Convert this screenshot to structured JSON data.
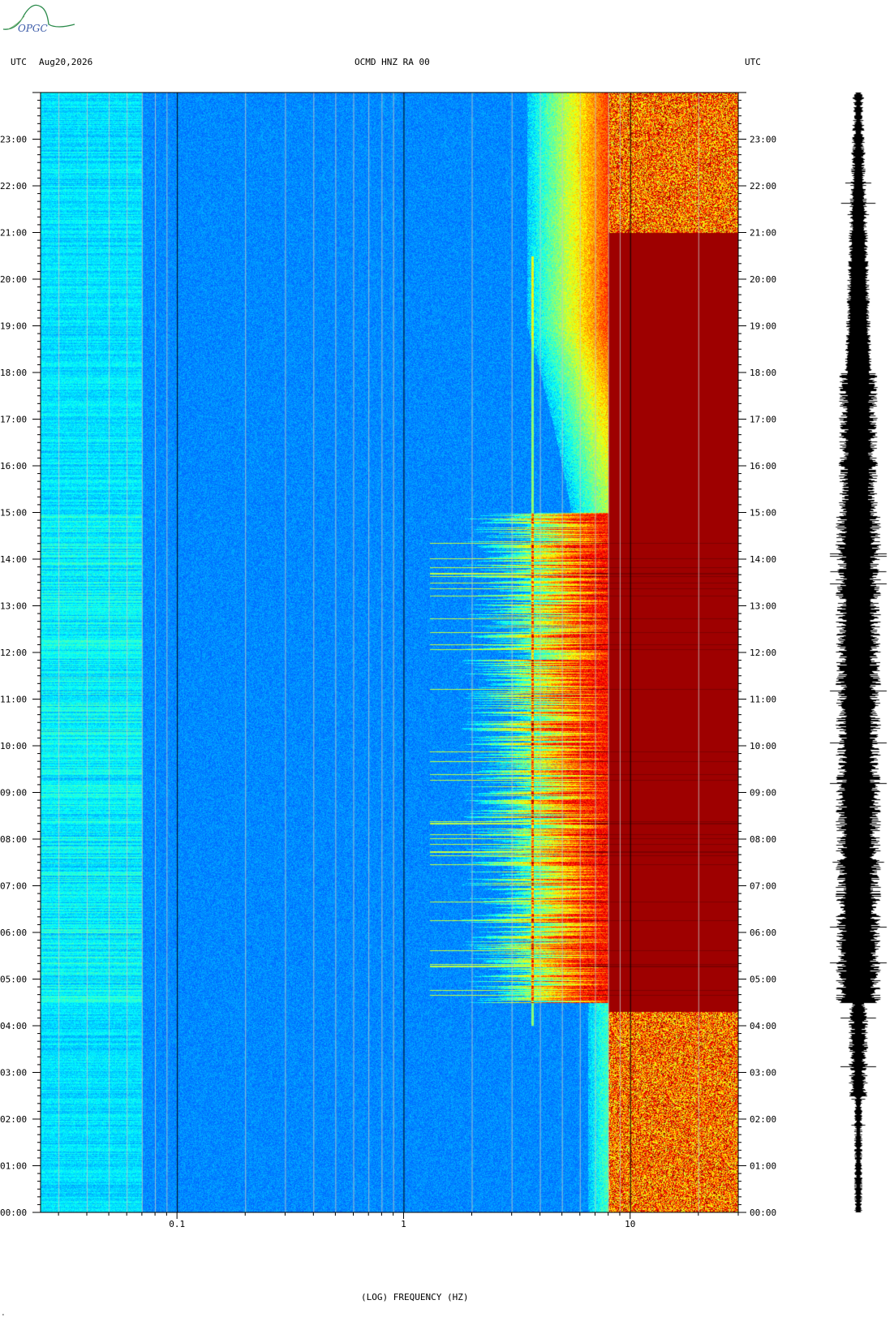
{
  "header": {
    "left_tz": "UTC",
    "date": "Aug20,2026",
    "station": "OCMD HNZ RA 00",
    "right_tz": "UTC"
  },
  "logo": {
    "text": "OPGC",
    "color": "#2a8a4a"
  },
  "footer": {
    "mark": "˚"
  },
  "chart_data": {
    "type": "heatmap",
    "title": "OCMD HNZ RA 00",
    "xlabel": "(LOG) FREQUENCY (HZ)",
    "ylabel": "UTC",
    "x_scale": "log",
    "xlim": [
      0.025,
      30
    ],
    "ylim_hours": [
      0,
      24
    ],
    "x_ticks": [
      {
        "value": 0.1,
        "label": "0.1"
      },
      {
        "value": 1,
        "label": "1"
      },
      {
        "value": 10,
        "label": "10"
      }
    ],
    "y_ticks": [
      "00:00",
      "01:00",
      "02:00",
      "03:00",
      "04:00",
      "05:00",
      "06:00",
      "07:00",
      "08:00",
      "09:00",
      "10:00",
      "11:00",
      "12:00",
      "13:00",
      "14:00",
      "15:00",
      "16:00",
      "17:00",
      "18:00",
      "19:00",
      "20:00",
      "21:00",
      "22:00",
      "23:00"
    ],
    "colormap": [
      "#00007f",
      "#0000ff",
      "#0080ff",
      "#00ffff",
      "#80ff80",
      "#ffff00",
      "#ff8000",
      "#ff0000",
      "#7f0000"
    ],
    "features": {
      "cultural_noise_band_hours": [
        4.5,
        15.0
      ],
      "saturated_above_hz": 8,
      "persistent_line_hz": 3.7
    },
    "seismogram": {
      "color": "#000000"
    }
  }
}
